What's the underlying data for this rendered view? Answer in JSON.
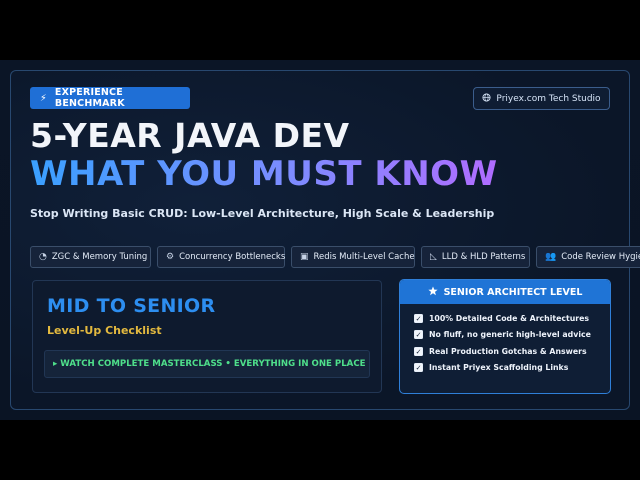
{
  "badge": {
    "icon": "lightning-icon",
    "label": "EXPERIENCE BENCHMARK"
  },
  "studio": {
    "icon": "globe-icon",
    "label": "Priyex.com Tech Studio"
  },
  "headline": {
    "line1": "5-YEAR JAVA DEV",
    "line2": "WHAT YOU MUST KNOW"
  },
  "subtitle": "Stop Writing Basic CRUD: Low-Level Architecture, High Scale & Leadership",
  "tags": [
    {
      "icon": "gauge-icon",
      "label": "ZGC & Memory Tuning"
    },
    {
      "icon": "gear-icon",
      "label": "Concurrency Bottlenecks"
    },
    {
      "icon": "database-icon",
      "label": "Redis Multi-Level Cache"
    },
    {
      "icon": "diagram-icon",
      "label": "LLD & HLD Patterns"
    },
    {
      "icon": "users-icon",
      "label": "Code Review Hygiene"
    }
  ],
  "left_panel": {
    "heading": "MID TO SENIOR",
    "subheading": "Level-Up Checklist",
    "cta": "▸ WATCH COMPLETE MASTERCLASS • EVERYTHING IN ONE PLACE"
  },
  "right_panel": {
    "icon": "star-icon",
    "heading": "SENIOR ARCHITECT LEVEL",
    "items": [
      "100% Detailed Code & Architectures",
      "No fluff, no generic high-level advice",
      "Real Production Gotchas & Answers",
      "Instant Priyex Scaffolding Links"
    ]
  },
  "colors": {
    "accent_blue": "#1f74d6",
    "heading_blue": "#2d8ef0",
    "gold": "#e3b93f",
    "green": "#4fe08b"
  }
}
